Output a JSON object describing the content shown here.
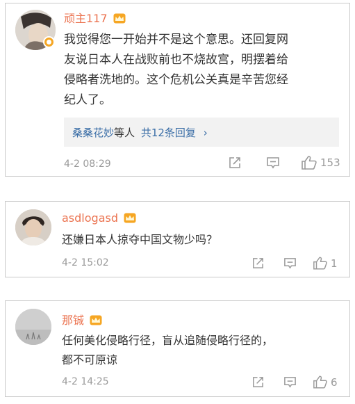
{
  "comments": [
    {
      "username": "顽主117",
      "text_lines": [
        "我觉得您一开始并不是这个意思。还回复网",
        "友说日本人在战败前也不烧故宫，明摆着给",
        "侵略者洗地的。这个危机公关真是辛苦您经",
        "纪人了。"
      ],
      "replies": {
        "names": "桑桑花妙",
        "suffix": "等人",
        "count_link": "共12条回复",
        "arrow": "›"
      },
      "timestamp": "4-2 08:29",
      "likes": "153"
    },
    {
      "username": "asdlogasd",
      "text_lines": [
        "还嫌日本人掠夺中国文物少吗？"
      ],
      "timestamp": "4-2 15:02",
      "likes": "1"
    },
    {
      "username": "那铖",
      "text_lines": [
        "任何美化侵略行径，盲从追随侵略行径的，",
        "都不可原谅"
      ],
      "timestamp": "4-2 14:25",
      "likes": "6"
    }
  ],
  "icons": [
    "share-icon",
    "comment-icon",
    "like-icon",
    "crown-badge-icon",
    "verified-badge-icon"
  ],
  "colors": {
    "username": "#eb7350",
    "text": "#333333",
    "meta": "#9a9a9a",
    "reply_link": "#3c6fa7",
    "reply_bg": "#f2f2f2",
    "badge": "#f5a623"
  }
}
